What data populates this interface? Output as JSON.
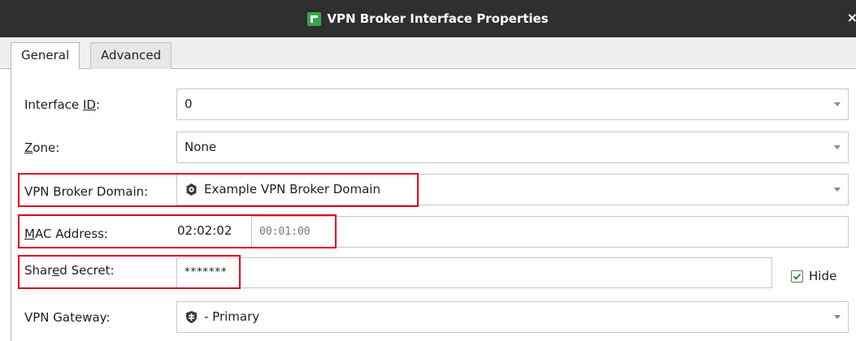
{
  "window": {
    "title": "VPN Broker Interface Properties",
    "close_glyph": "×"
  },
  "tabs": [
    {
      "label": "General",
      "active": true
    },
    {
      "label": "Advanced",
      "active": false
    }
  ],
  "form": {
    "interface_id": {
      "label_pre": "Interface ",
      "label_mnemonic": "I",
      "label_mid": "",
      "label_mnemonic2": "D",
      "label_post": ":",
      "value": "0"
    },
    "zone": {
      "label_mnemonic": "Z",
      "label_post": "one:",
      "value": "None"
    },
    "vpn_broker_domain": {
      "label": "VPN Broker Domain:",
      "value": "Example VPN Broker Domain",
      "icon": "gear-network-icon"
    },
    "mac_address": {
      "label_mnemonic": "M",
      "label_post": "AC Address:",
      "prefix": "02:02:02",
      "suffix": "00:01:00"
    },
    "shared_secret": {
      "label_pre": "Shar",
      "label_mnemonic": "e",
      "label_post": "d Secret:",
      "value": "*******"
    },
    "hide_checkbox": {
      "label": "Hide",
      "checked": true
    },
    "vpn_gateway": {
      "label": "VPN Gateway:",
      "value": "- Primary",
      "icon": "gateway-shield-icon"
    }
  },
  "colors": {
    "titlebar": "#2f2f2f",
    "highlight": "#e0001b",
    "check": "#2e8b3a"
  }
}
